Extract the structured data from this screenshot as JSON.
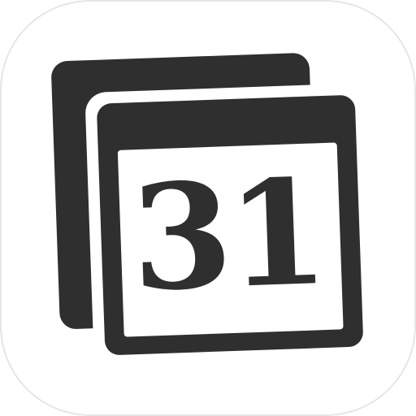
{
  "app_icon": {
    "day_number": "31",
    "colors": {
      "tile_background": "#ffffff",
      "tile_border": "#e6e6e6",
      "ink": "#2f2f2f",
      "page": "#ffffff"
    }
  }
}
